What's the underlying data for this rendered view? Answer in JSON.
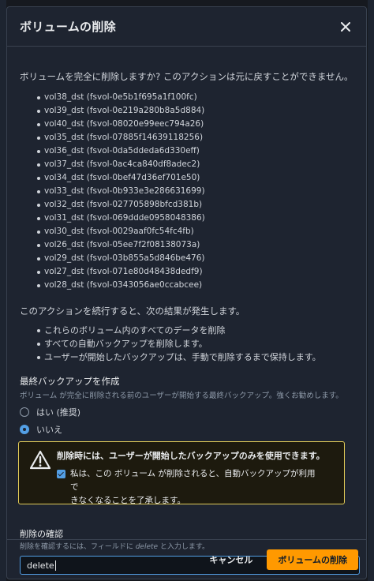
{
  "dialog": {
    "title": "ボリュームの削除",
    "lead": "ボリュームを完全に削除しますか? このアクションは元に戻すことができません。",
    "volumes": [
      "vol38_dst (fsvol-0e5b1f695a1f100fc)",
      "vol39_dst (fsvol-0e219a280b8a5d884)",
      "vol40_dst (fsvol-08020e99eec794a26)",
      "vol35_dst (fsvol-07885f14639118256)",
      "vol36_dst (fsvol-0da5ddeda6d330eff)",
      "vol37_dst (fsvol-0ac4ca840df8adec2)",
      "vol34_dst (fsvol-0bef47d36ef701e50)",
      "vol33_dst (fsvol-0b933e3e286631699)",
      "vol32_dst (fsvol-027705898bfcd381b)",
      "vol31_dst (fsvol-069ddde0958048386)",
      "vol30_dst (fsvol-0029aaf0fc54fc4fb)",
      "vol26_dst (fsvol-05ee7f2f08138073a)",
      "vol29_dst (fsvol-03b855a5d846be476)",
      "vol27_dst (fsvol-071e80d48438dedf9)",
      "vol28_dst (fsvol-0343056ae0ccabcee)"
    ],
    "consequence": "このアクションを続行すると、次の結果が発生します。",
    "effects": [
      "これらのボリューム内のすべてのデータを削除",
      "すべての自動バックアップを削除します。",
      "ユーザーが開始したバックアップは、手動で削除するまで保持します。"
    ],
    "backup": {
      "label": "最終バックアップを作成",
      "description": "ボリューム が完全に削除される前のユーザーが開始する最終バックアップ。強くお勧めします。",
      "options": [
        {
          "label": "はい (推奨)",
          "selected": false
        },
        {
          "label": "いいえ",
          "selected": true
        }
      ]
    },
    "warning": {
      "title": "削除時には、ユーザーが開始したバックアップのみを使用できます。",
      "ack_line1": "私は、この ボリューム が削除されると、自動バックアップが利用で",
      "ack_line2": "きなくなることを了承します。",
      "ack_checked": true
    },
    "confirm": {
      "label": "削除の確認",
      "desc_prefix": "削除を確認するには、フィールドに ",
      "desc_keyword": "delete",
      "desc_suffix": " と入力します。",
      "value": "delete"
    },
    "cancel_label": "キャンセル",
    "delete_label": "ボリュームの削除"
  },
  "colors": {
    "primary_button": "#ff9900",
    "accent": "#539fe5",
    "warning_border": "#e0ca57"
  }
}
